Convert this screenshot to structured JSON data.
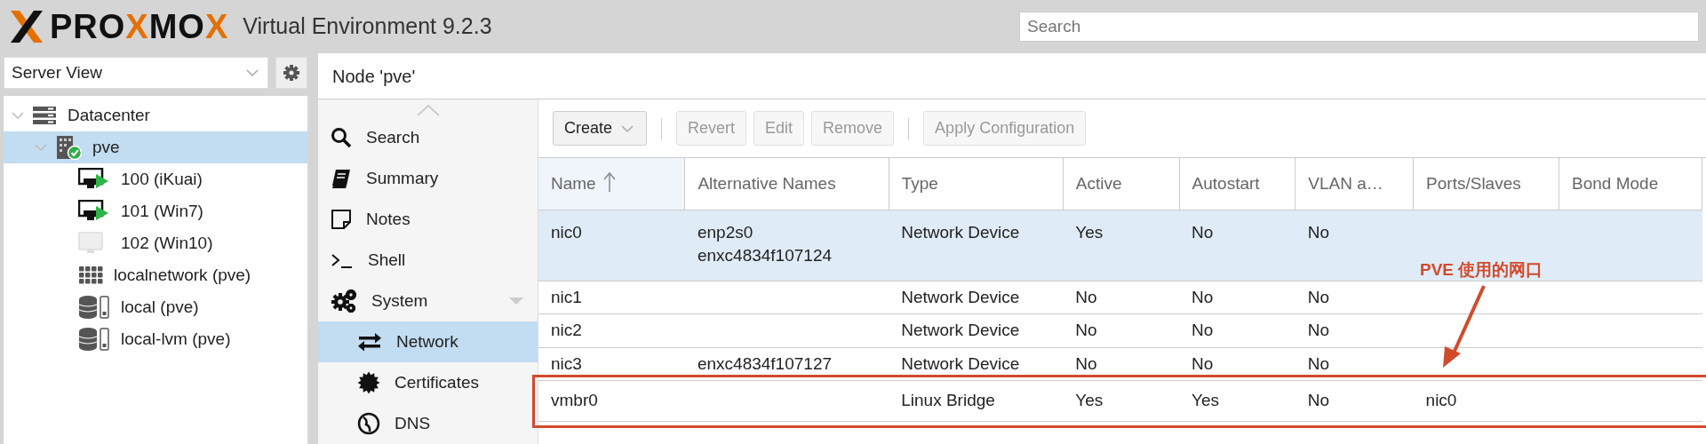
{
  "header": {
    "logo": [
      {
        "text": "PRO",
        "accent": false
      },
      {
        "text": "X",
        "accent": true
      },
      {
        "text": "MO",
        "accent": false
      },
      {
        "text": "X",
        "accent": true
      }
    ],
    "title": "Virtual Environment 9.2.3",
    "search": {
      "placeholder": "Search"
    }
  },
  "sidebar": {
    "view_select": {
      "value": "Server View"
    },
    "tree": [
      {
        "label": "Datacenter",
        "kind": "datacenter",
        "expanded": true,
        "selected": false,
        "children": [
          {
            "label": "pve",
            "kind": "node",
            "expanded": true,
            "selected": true,
            "children": [
              {
                "label": "100 (iKuai)",
                "kind": "vm",
                "running": true,
                "selected": false
              },
              {
                "label": "101 (Win7)",
                "kind": "vm",
                "running": true,
                "selected": false
              },
              {
                "label": "102 (Win10)",
                "kind": "vm",
                "running": false,
                "selected": false
              },
              {
                "label": "localnetwork (pve)",
                "kind": "sdn",
                "selected": false
              },
              {
                "label": "local (pve)",
                "kind": "storage",
                "selected": false
              },
              {
                "label": "local-lvm (pve)",
                "kind": "storage",
                "selected": false
              }
            ]
          }
        ]
      }
    ]
  },
  "panel_title": "Node 'pve'",
  "nav": [
    {
      "label": "Search",
      "kind": "search",
      "selected": false
    },
    {
      "label": "Summary",
      "kind": "summary",
      "selected": false
    },
    {
      "label": "Notes",
      "kind": "notes",
      "selected": false
    },
    {
      "label": "Shell",
      "kind": "shell",
      "selected": false
    },
    {
      "label": "System",
      "kind": "system",
      "selected": false,
      "expanded": true,
      "children": [
        {
          "label": "Network",
          "kind": "network",
          "selected": true
        },
        {
          "label": "Certificates",
          "kind": "certificates",
          "selected": false
        },
        {
          "label": "DNS",
          "kind": "dns",
          "selected": false
        }
      ]
    }
  ],
  "toolbar": [
    {
      "label": "Create",
      "kind": "menu",
      "disabled": false
    },
    {
      "label": "Revert",
      "kind": "button",
      "disabled": true
    },
    {
      "label": "Edit",
      "kind": "button",
      "disabled": true
    },
    {
      "label": "Remove",
      "kind": "button",
      "disabled": true
    },
    {
      "label": "Apply Configuration",
      "kind": "button",
      "disabled": true
    }
  ],
  "table": {
    "columns": [
      {
        "label": "Name",
        "sorted": true
      },
      {
        "label": "Alternative Names",
        "sorted": false
      },
      {
        "label": "Type",
        "sorted": false
      },
      {
        "label": "Active",
        "sorted": false
      },
      {
        "label": "Autostart",
        "sorted": false
      },
      {
        "label": "VLAN a…",
        "sorted": false
      },
      {
        "label": "Ports/Slaves",
        "sorted": false
      },
      {
        "label": "Bond Mode",
        "sorted": false
      }
    ],
    "rows": [
      {
        "selected": true,
        "highlighted": false,
        "cells": [
          "nic0",
          [
            "enp2s0",
            "enxc4834f107124"
          ],
          "Network Device",
          "Yes",
          "No",
          "No",
          "",
          ""
        ]
      },
      {
        "selected": false,
        "highlighted": false,
        "cells": [
          "nic1",
          "",
          "Network Device",
          "No",
          "No",
          "No",
          "",
          ""
        ]
      },
      {
        "selected": false,
        "highlighted": false,
        "cells": [
          "nic2",
          "",
          "Network Device",
          "No",
          "No",
          "No",
          "",
          ""
        ]
      },
      {
        "selected": false,
        "highlighted": false,
        "cells": [
          "nic3",
          "enxc4834f107127",
          "Network Device",
          "No",
          "No",
          "No",
          "",
          ""
        ]
      },
      {
        "selected": false,
        "highlighted": true,
        "cells": [
          "vmbr0",
          "",
          "Linux Bridge",
          "Yes",
          "Yes",
          "No",
          "nic0",
          ""
        ]
      }
    ]
  },
  "annotation": {
    "text": "PVE 使用的网口"
  }
}
